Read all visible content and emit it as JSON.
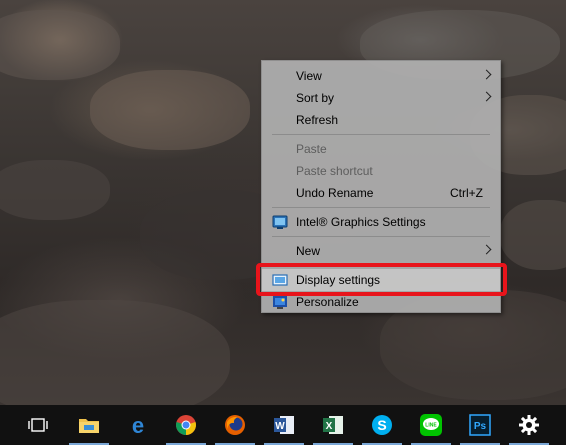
{
  "context_menu": {
    "view": "View",
    "sort_by": "Sort by",
    "refresh": "Refresh",
    "paste": "Paste",
    "paste_shortcut": "Paste shortcut",
    "undo_rename": "Undo Rename",
    "undo_rename_shortcut": "Ctrl+Z",
    "intel_graphics": "Intel® Graphics Settings",
    "new": "New",
    "display_settings": "Display settings",
    "personalize": "Personalize"
  },
  "colors": {
    "highlight_border": "#e8141b",
    "menu_background": "#afafaf",
    "taskbar": "#111111"
  },
  "taskbar": {
    "items": [
      {
        "icon": "task-view-icon"
      },
      {
        "icon": "file-explorer-icon"
      },
      {
        "icon": "edge-icon"
      },
      {
        "icon": "chrome-icon"
      },
      {
        "icon": "firefox-icon"
      },
      {
        "icon": "word-icon"
      },
      {
        "icon": "excel-icon"
      },
      {
        "icon": "skype-icon"
      },
      {
        "icon": "line-icon"
      },
      {
        "icon": "photoshop-icon"
      },
      {
        "icon": "settings-gear-icon"
      }
    ]
  }
}
